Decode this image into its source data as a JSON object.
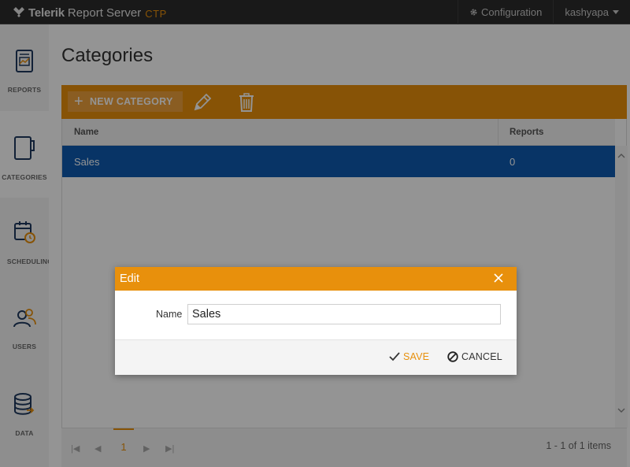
{
  "app": {
    "brand": "Telerik",
    "product": "Report Server",
    "tag": "CTP"
  },
  "topnav": {
    "configuration": "Configuration",
    "user": "kashyapa"
  },
  "sidebar": {
    "items": [
      {
        "label": "REPORTS",
        "icon": "report-icon"
      },
      {
        "label": "CATEGORIES",
        "icon": "categories-icon",
        "active": true
      },
      {
        "label": "SCHEDULING",
        "icon": "calendar-clock-icon"
      },
      {
        "label": "USERS",
        "icon": "users-icon"
      },
      {
        "label": "DATA",
        "icon": "database-icon"
      }
    ]
  },
  "page": {
    "title": "Categories"
  },
  "toolbar": {
    "new_label": "NEW CATEGORY",
    "edit_icon": "pencil-icon",
    "delete_icon": "trash-icon"
  },
  "grid": {
    "columns": [
      "Name",
      "Reports"
    ],
    "rows": [
      {
        "name": "Sales",
        "reports": "0",
        "selected": true
      }
    ]
  },
  "pager": {
    "current_page": "1",
    "info": "1 - 1 of 1 items"
  },
  "dialog": {
    "title": "Edit",
    "name_label": "Name",
    "name_value": "Sales",
    "save_label": "SAVE",
    "cancel_label": "CANCEL"
  },
  "colors": {
    "accent": "#e8900c",
    "selection": "#0e5bb0",
    "topbar": "#2b2b2b"
  }
}
